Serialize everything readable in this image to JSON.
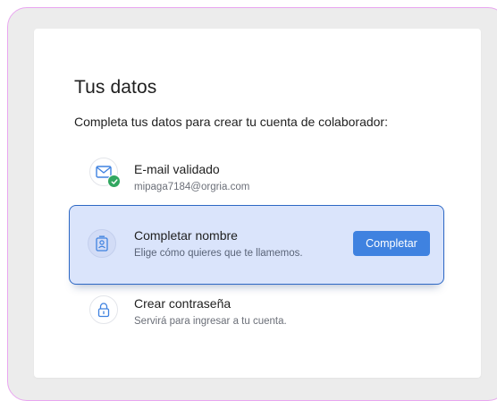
{
  "page": {
    "title": "Tus datos",
    "subtitle": "Completa tus datos para crear tu cuenta de colaborador:"
  },
  "steps": [
    {
      "label": "E-mail validado",
      "description": "mipaga7184@orgria.com",
      "icon": "mail-icon",
      "status": "completed"
    },
    {
      "label": "Completar nombre",
      "description": "Elige cómo quieres que te llamemos.",
      "icon": "id-badge-icon",
      "status": "active",
      "button_label": "Completar"
    },
    {
      "label": "Crear contraseña",
      "description": "Servirá para ingresar a tu cuenta.",
      "icon": "lock-icon",
      "status": "pending"
    }
  ],
  "colors": {
    "accent": "#3f82e0",
    "active_border": "#2d68c4",
    "active_background": "#dae4fb",
    "success": "#31a760",
    "frame_border": "#e9a6f0"
  }
}
